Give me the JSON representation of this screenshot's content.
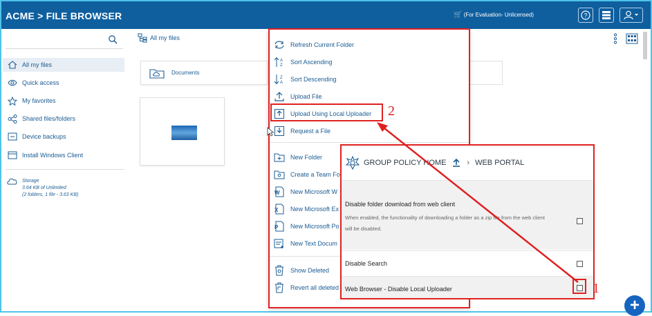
{
  "header": {
    "brand": "ACME  >  FILE BROWSER",
    "license": "(For Evaluation- Unlicensed)"
  },
  "sidebar": {
    "items": [
      {
        "label": "All my files",
        "icon": "home-icon"
      },
      {
        "label": "Quick access",
        "icon": "eye-icon"
      },
      {
        "label": "My favorites",
        "icon": "star-icon"
      },
      {
        "label": "Shared files/folders",
        "icon": "share-icon"
      },
      {
        "label": "Device backups",
        "icon": "backup-icon"
      },
      {
        "label": "Install Windows Client",
        "icon": "windows-client-icon"
      }
    ],
    "storage": {
      "title": "Storage",
      "line1": "3.64 KB of Unlimited",
      "line2": "(2 folders, 1 file - 3.63 KB)"
    }
  },
  "main": {
    "breadcrumb": "All my files",
    "folder": "Documents"
  },
  "context_menu": {
    "items": [
      "Refresh Current Folder",
      "Sort Ascending",
      "Sort Descending",
      "Upload File",
      "Upload Using Local Uploader",
      "Request a File",
      "New Folder",
      "Create a Team Fo",
      "New Microsoft W",
      "New Microsoft Ex",
      "New Microsoft Po",
      "New Text Docum",
      "Show Deleted",
      "Revert all deleted"
    ]
  },
  "callouts": {
    "one": "1",
    "two": "2"
  },
  "policy_panel": {
    "crumb1": "GROUP POLICY HOME",
    "crumb2": "WEB PORTAL",
    "rows": [
      {
        "title": "Disable folder download from web client",
        "desc": "When enabled, the functionality of downloading a folder as a zip file from the web client will be disabled.",
        "checked": false
      },
      {
        "title": "Disable Search",
        "checked": false
      },
      {
        "title": "Web Browser - Disable Local Uploader",
        "checked": false
      }
    ]
  },
  "colors": {
    "header": "#0f5f9f",
    "accent": "#1b5c93",
    "callout": "#e02020"
  }
}
